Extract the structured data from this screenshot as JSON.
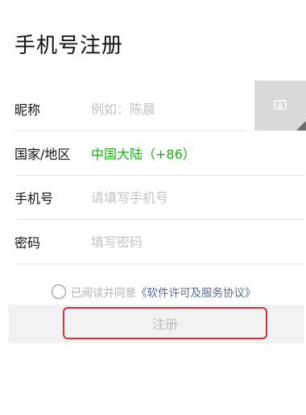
{
  "page": {
    "title": "手机号注册"
  },
  "form": {
    "nickname": {
      "label": "昵称",
      "placeholder": "例如：陈晨"
    },
    "country": {
      "label": "国家/地区",
      "value": "中国大陆（+86）"
    },
    "phone": {
      "label": "手机号",
      "placeholder": "请填写手机号"
    },
    "password": {
      "label": "密码",
      "placeholder": "填写密码"
    }
  },
  "avatar": {
    "icon": "camera-icon"
  },
  "agreement": {
    "text": "已阅读并同意",
    "link": "《软件许可及服务协议》",
    "checked": false
  },
  "submit": {
    "label": "注册"
  },
  "colors": {
    "accent_green": "#1aad19",
    "link_blue": "#576b95",
    "highlight_red": "#d0343c"
  }
}
